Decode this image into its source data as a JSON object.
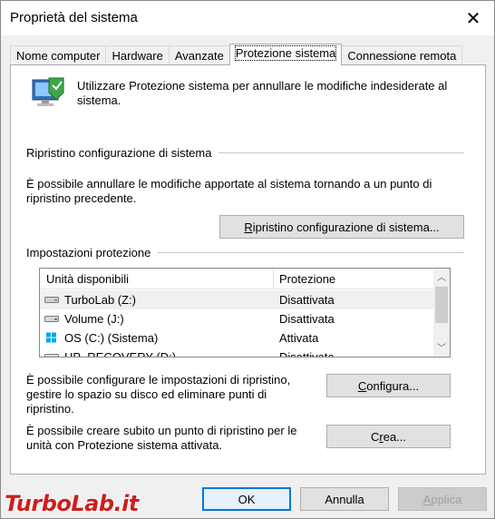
{
  "window": {
    "title": "Proprietà del sistema"
  },
  "tabs": [
    {
      "label": "Nome computer"
    },
    {
      "label": "Hardware"
    },
    {
      "label": "Avanzate"
    },
    {
      "label": "Protezione sistema"
    },
    {
      "label": "Connessione remota"
    }
  ],
  "intro": {
    "text": "Utilizzare Protezione sistema per annullare le modifiche indesiderate al sistema."
  },
  "restore_group": {
    "title": "Ripristino configurazione di sistema",
    "description": "È possibile annullare le modifiche apportate al sistema tornando a un punto di ripristino precedente.",
    "button_prefix": "",
    "button_underlined": "R",
    "button_rest": "ipristino configurazione di sistema..."
  },
  "protection_group": {
    "title": "Impostazioni protezione",
    "columns": {
      "drive": "Unità disponibili",
      "protection": "Protezione"
    },
    "rows": [
      {
        "drive": "TurboLab (Z:)",
        "protection": "Disattivata",
        "icon": "network-drive-icon"
      },
      {
        "drive": "Volume (J:)",
        "protection": "Disattivata",
        "icon": "hard-drive-icon"
      },
      {
        "drive": "OS (C:) (Sistema)",
        "protection": "Attivata",
        "icon": "system-drive-icon"
      },
      {
        "drive": "HP_RECOVERY (D:)",
        "protection": "Disattivata",
        "icon": "hard-drive-icon"
      }
    ],
    "configure_text": "È possibile configurare le impostazioni di ripristino, gestire lo spazio su disco ed eliminare punti di ripristino.",
    "configure_btn_u": "C",
    "configure_btn_rest": "onfigura...",
    "create_text": "È possibile creare subito un punto di ripristino per le unità con Protezione sistema attivata.",
    "create_btn_u": "r",
    "create_btn_prefix": "C",
    "create_btn_rest": "ea..."
  },
  "footer": {
    "ok": "OK",
    "cancel": "Annulla",
    "apply_u": "A",
    "apply_rest": "pplica"
  },
  "watermark": "TurboLab.it",
  "colors": {
    "accent": "#0078d7",
    "watermark": "#cc1f1f"
  }
}
